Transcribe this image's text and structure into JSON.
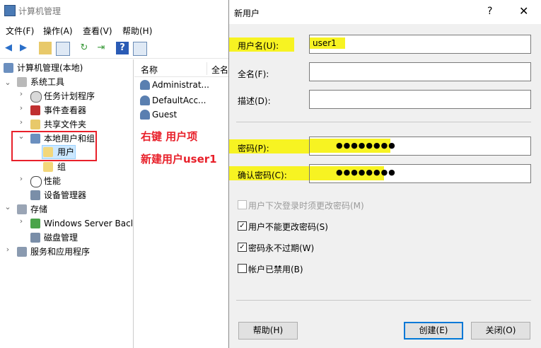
{
  "app": {
    "title": "计算机管理",
    "menu": [
      "文件(F)",
      "操作(A)",
      "查看(V)",
      "帮助(H)"
    ]
  },
  "tree": {
    "root": "计算机管理(本地)",
    "system_tools": "系统工具",
    "task_scheduler": "任务计划程序",
    "event_viewer": "事件查看器",
    "shared_folders": "共享文件夹",
    "local_users_groups": "本地用户和组",
    "users": "用户",
    "groups": "组",
    "performance": "性能",
    "device_manager": "设备管理器",
    "storage": "存储",
    "windows_server_backup": "Windows Server Back",
    "disk_management": "磁盘管理",
    "services_apps": "服务和应用程序"
  },
  "list": {
    "col_name": "名称",
    "col_fullname": "全名",
    "rows": [
      "Administrat...",
      "DefaultAcc...",
      "Guest"
    ]
  },
  "annotations": {
    "line1": "右键 用户项",
    "line2": "新建用户user1"
  },
  "dialog": {
    "title": "新用户",
    "help_icon": "?",
    "close_icon": "✕",
    "username_label": "用户名(U):",
    "username_value": "user1",
    "fullname_label": "全名(F):",
    "fullname_value": "",
    "description_label": "描述(D):",
    "description_value": "",
    "password_label": "密码(P):",
    "password_value": "●●●●●●●●",
    "confirm_label": "确认密码(C):",
    "confirm_value": "●●●●●●●●",
    "chk_must_change": "用户下次登录时须更改密码(M)",
    "chk_cannot_change": "用户不能更改密码(S)",
    "chk_never_expires": "密码永不过期(W)",
    "chk_disabled": "帐户已禁用(B)",
    "check_mark": "✓",
    "help_button": "帮助(H)",
    "create_button": "创建(E)",
    "close_button": "关闭(O)",
    "highlight_color": "#f7f322",
    "annotation_color": "#e8202a"
  }
}
